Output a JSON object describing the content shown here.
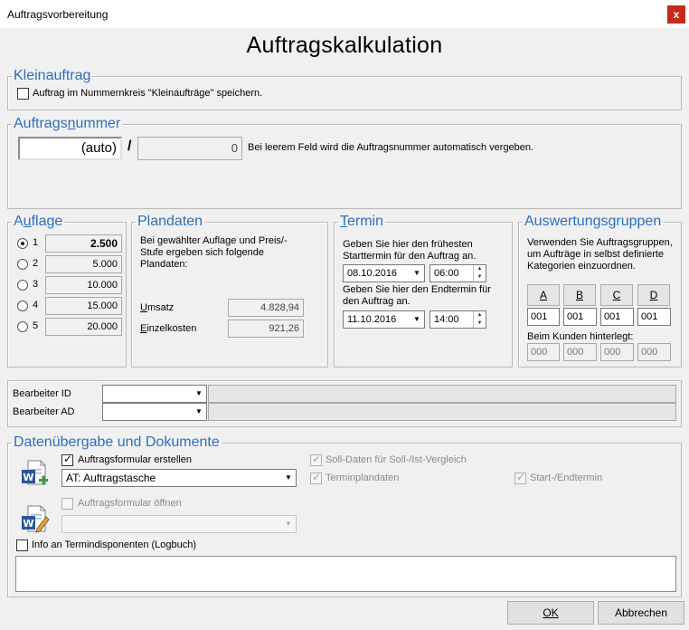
{
  "window": {
    "title": "Auftragsvorbereitung",
    "close": "x"
  },
  "heading": "Auftragskalkulation",
  "kleinauftrag": {
    "legend": "Kleinauftrag",
    "checkbox_label": "Auftrag im Nummernkreis \"Kleinaufträge\" speichern.",
    "checked": false
  },
  "auftragsnummer": {
    "legend": "Auftragsnummer",
    "field1": "(auto)",
    "slash": "/",
    "field2": "0",
    "hint": "Bei leerem Feld wird die Auftragsnummer automatisch vergeben."
  },
  "auflage": {
    "legend": "Auflage",
    "items": [
      {
        "n": "1",
        "value": "2.500",
        "selected": true
      },
      {
        "n": "2",
        "value": "5.000",
        "selected": false
      },
      {
        "n": "3",
        "value": "10.000",
        "selected": false
      },
      {
        "n": "4",
        "value": "15.000",
        "selected": false
      },
      {
        "n": "5",
        "value": "20.000",
        "selected": false
      }
    ]
  },
  "plandaten": {
    "legend": "Plandaten",
    "desc": "Bei gewählter Auflage und Preis/-Stufe ergeben sich folgende Plandaten:",
    "umsatz_label": "Umsatz",
    "umsatz_value": "4.828,94",
    "einzelkosten_label": "Einzelkosten",
    "einzelkosten_value": "921,26"
  },
  "termin": {
    "legend": "Termin",
    "start_desc": "Geben Sie hier den frühesten Starttermin für den Auftrag an.",
    "start_date": "08.10.2016",
    "start_time": "06:00",
    "end_desc": "Geben Sie hier den Endtermin für den Auftrag an.",
    "end_date": "11.10.2016",
    "end_time": "14:00"
  },
  "auswertung": {
    "legend": "Auswertungsgruppen",
    "desc": "Verwenden Sie Auftragsgruppen, um Aufträge in selbst definierte Kategorien einzuordnen.",
    "groups": [
      {
        "label": "A",
        "value": "001",
        "customer": "000"
      },
      {
        "label": "B",
        "value": "001",
        "customer": "000"
      },
      {
        "label": "C",
        "value": "001",
        "customer": "000"
      },
      {
        "label": "D",
        "value": "001",
        "customer": "000"
      }
    ],
    "customer_label": "Beim Kunden hinterlegt:"
  },
  "bearbeiter": {
    "id_label": "Bearbeiter ID",
    "id_value": "",
    "ad_label": "Bearbeiter AD",
    "ad_value": ""
  },
  "daten": {
    "legend": "Datenübergabe und Dokumente",
    "formular_erstellen_label": "Auftragsformular erstellen",
    "formular_erstellen_checked": true,
    "template_value": "AT: Auftragstasche",
    "formular_oeffnen_label": "Auftragsformular öffnen",
    "formular_oeffnen_checked": false,
    "soll_label": "Soll-Daten für Soll-/Ist-Vergleich",
    "terminplandaten_label": "Terminplandaten",
    "startend_label": "Start-/Endtermin",
    "info_label": "Info an Termindisponenten (Logbuch)",
    "info_checked": false,
    "memo": ""
  },
  "buttons": {
    "ok": "OK",
    "cancel": "Abbrechen"
  }
}
